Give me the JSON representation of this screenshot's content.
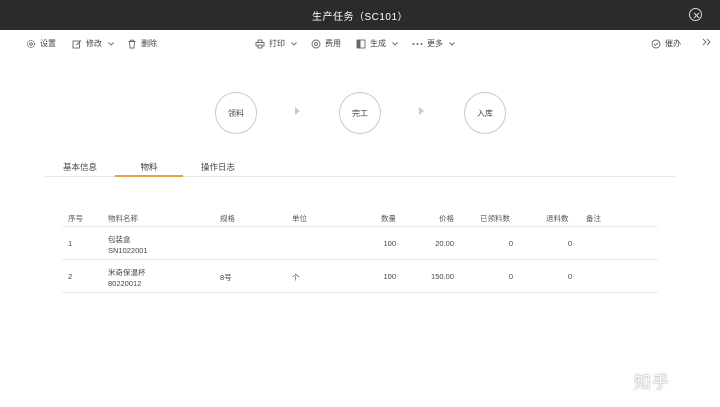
{
  "window": {
    "title": "生产任务（SC101）"
  },
  "toolbar": {
    "settings": "设置",
    "edit": "修改",
    "delete": "删除",
    "print": "打印",
    "expense": "费用",
    "generate": "生成",
    "more": "更多",
    "urge": "催办"
  },
  "steps": [
    "领料",
    "完工",
    "入库"
  ],
  "tabs": [
    "基本信息",
    "物料",
    "操作日志"
  ],
  "active_tab": "物料",
  "table": {
    "headers": {
      "seq": "序号",
      "name": "物料名称",
      "spec": "规格",
      "unit": "单位",
      "qty": "数量",
      "price": "价格",
      "picked": "已领料数",
      "returned": "退料数",
      "remark": "备注"
    },
    "rows": [
      {
        "seq": "1",
        "name": "包装盒",
        "code": "SN1022001",
        "spec": "",
        "unit": "",
        "qty": "100",
        "price": "20.00",
        "picked": "0",
        "returned": "0",
        "remark": ""
      },
      {
        "seq": "2",
        "name": "米奇保温杯",
        "code": "80220012",
        "spec": "8号",
        "unit": "个",
        "qty": "100",
        "price": "150.00",
        "picked": "0",
        "returned": "0",
        "remark": ""
      }
    ]
  },
  "watermark": "知乎",
  "colors": {
    "titlebar": "#2b2b2b",
    "accent": "#e8a23c"
  }
}
